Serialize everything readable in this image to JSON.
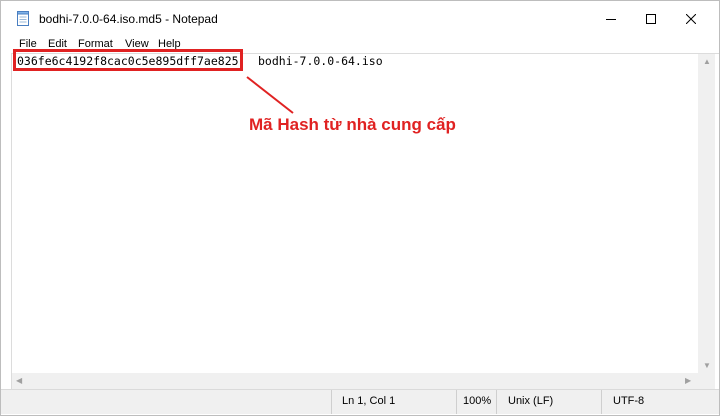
{
  "window": {
    "title": "bodhi-7.0.0-64.iso.md5 - Notepad"
  },
  "menu": [
    "File",
    "Edit",
    "Format",
    "View",
    "Help"
  ],
  "content": {
    "hash": "036fe6c4192f8cac0c5e895dff7ae825",
    "filename": "bodhi-7.0.0-64.iso"
  },
  "annotation": {
    "text": "Mã Hash từ nhà cung cấp",
    "color": "#e02222"
  },
  "status": {
    "position": "Ln 1, Col 1",
    "zoom": "100%",
    "line_ending": "Unix (LF)",
    "encoding": "UTF-8"
  },
  "icons": {
    "app": "notepad-icon",
    "minimize": "minimize-icon",
    "maximize": "maximize-icon",
    "close": "close-icon"
  }
}
